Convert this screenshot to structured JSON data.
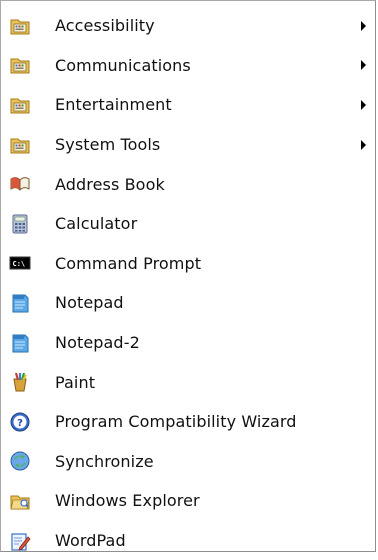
{
  "menu": {
    "items": [
      {
        "label": "Accessibility",
        "icon": "program-group-folder-icon",
        "submenu": true
      },
      {
        "label": "Communications",
        "icon": "program-group-folder-icon",
        "submenu": true
      },
      {
        "label": "Entertainment",
        "icon": "program-group-folder-icon",
        "submenu": true
      },
      {
        "label": "System Tools",
        "icon": "program-group-folder-icon",
        "submenu": true
      },
      {
        "label": "Address Book",
        "icon": "address-book-icon",
        "submenu": false
      },
      {
        "label": "Calculator",
        "icon": "calculator-icon",
        "submenu": false
      },
      {
        "label": "Command Prompt",
        "icon": "command-prompt-icon",
        "submenu": false
      },
      {
        "label": "Notepad",
        "icon": "notepad-icon",
        "submenu": false
      },
      {
        "label": "Notepad-2",
        "icon": "notepad-icon",
        "submenu": false
      },
      {
        "label": "Paint",
        "icon": "paint-icon",
        "submenu": false
      },
      {
        "label": "Program Compatibility Wizard",
        "icon": "help-wizard-icon",
        "submenu": false
      },
      {
        "label": "Synchronize",
        "icon": "synchronize-icon",
        "submenu": false
      },
      {
        "label": "Windows Explorer",
        "icon": "explorer-folder-icon",
        "submenu": false
      },
      {
        "label": "WordPad",
        "icon": "wordpad-icon",
        "submenu": false
      }
    ]
  },
  "colors": {
    "text": "#111111",
    "border": "#8f8f8f",
    "folder": "#e8c25a",
    "accent_blue": "#3a6fc9"
  }
}
